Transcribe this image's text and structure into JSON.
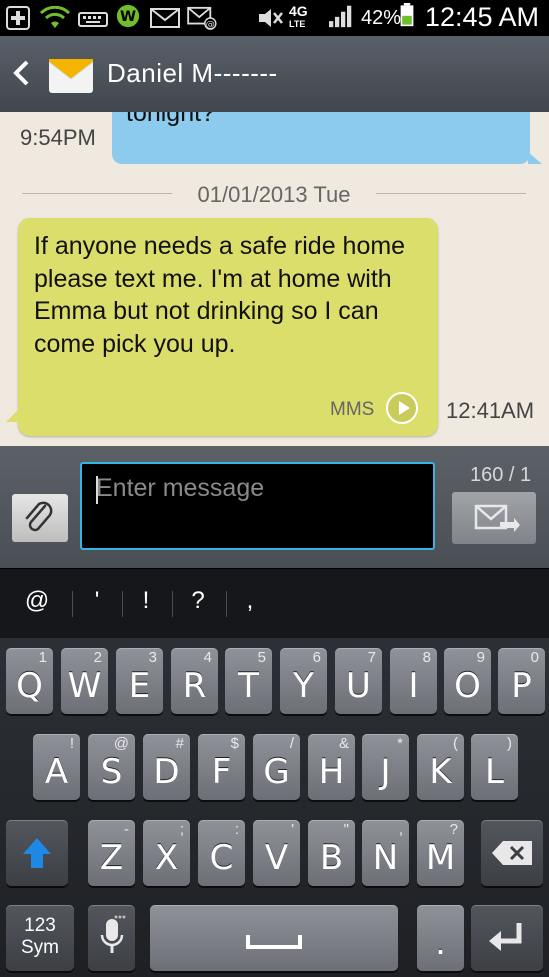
{
  "status_bar": {
    "time": "12:45 AM",
    "battery_percent": "42%",
    "network_label_top": "4G",
    "network_label_bottom": "LTE",
    "icons": [
      "plus-icon",
      "wifi-icon",
      "keyboard-icon",
      "whatsapp-icon",
      "mail-icon",
      "email-at-icon",
      "mute-icon",
      "signal-icon",
      "battery-icon"
    ]
  },
  "header": {
    "contact_name": "Daniel M-------"
  },
  "conversation": {
    "outgoing": {
      "text_partial": "Sup buddy?  You guys out\ntonight?",
      "time": "9:54PM"
    },
    "date_separator": "01/01/2013 Tue",
    "incoming": {
      "text": "If anyone needs a safe ride home please text me. I'm at home with Emma but not drinking so I can come pick you up.",
      "badge": "MMS",
      "time": "12:41AM"
    }
  },
  "composer": {
    "placeholder": "Enter message",
    "counter": "160 / 1"
  },
  "symbol_row": [
    "@",
    "'",
    "!",
    "?",
    ","
  ],
  "keyboard": {
    "row1": [
      {
        "main": "Q",
        "sub": "1"
      },
      {
        "main": "W",
        "sub": "2"
      },
      {
        "main": "E",
        "sub": "3"
      },
      {
        "main": "R",
        "sub": "4"
      },
      {
        "main": "T",
        "sub": "5"
      },
      {
        "main": "Y",
        "sub": "6"
      },
      {
        "main": "U",
        "sub": "7"
      },
      {
        "main": "I",
        "sub": "8"
      },
      {
        "main": "O",
        "sub": "9"
      },
      {
        "main": "P",
        "sub": "0"
      }
    ],
    "row2": [
      {
        "main": "A",
        "sub": "!"
      },
      {
        "main": "S",
        "sub": "@"
      },
      {
        "main": "D",
        "sub": "#"
      },
      {
        "main": "F",
        "sub": "$"
      },
      {
        "main": "G",
        "sub": "/"
      },
      {
        "main": "H",
        "sub": "&"
      },
      {
        "main": "J",
        "sub": "*"
      },
      {
        "main": "K",
        "sub": "("
      },
      {
        "main": "L",
        "sub": ")"
      }
    ],
    "row3": [
      {
        "main": "Z",
        "sub": "-"
      },
      {
        "main": "X",
        "sub": ";"
      },
      {
        "main": "C",
        "sub": ":"
      },
      {
        "main": "V",
        "sub": "'"
      },
      {
        "main": "B",
        "sub": "\""
      },
      {
        "main": "N",
        "sub": ","
      },
      {
        "main": "M",
        "sub": "?"
      }
    ],
    "sym_key_top": "123",
    "sym_key_bottom": "Sym",
    "period_key": "."
  },
  "colors": {
    "outgoing_bubble": "#8ccaee",
    "incoming_bubble": "#dbde6a",
    "conversation_bg": "#efe9df",
    "accent": "#33b5e5",
    "shift_blue": "#1e88e5"
  }
}
